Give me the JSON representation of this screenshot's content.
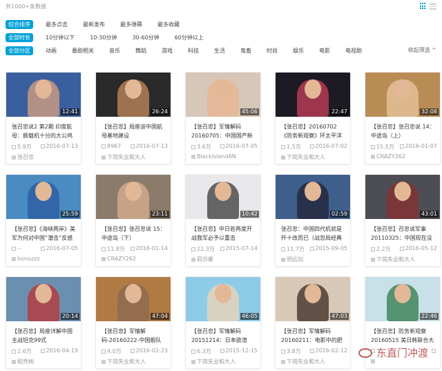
{
  "header": {
    "total": "共1000+条数据"
  },
  "sort_row": [
    "综合排序",
    "最多点击",
    "最新发布",
    "最多弹幕",
    "最多收藏"
  ],
  "duration_row": [
    "全部时长",
    "10分钟以下",
    "10-30分钟",
    "30-60分钟",
    "60分钟以上"
  ],
  "category_row": [
    "全部分区",
    "动画",
    "番剧相关",
    "音乐",
    "舞蹈",
    "游戏",
    "科技",
    "生活",
    "鬼畜",
    "时尚",
    "娱乐",
    "电影",
    "电视剧"
  ],
  "fold_label": "收起筛选 ^",
  "watermark": "东直门冲渡",
  "cards": [
    {
      "title": "张召忠说2 第2期 印度航母：舰载机十分的大公鸡",
      "duration": "12:41",
      "plays": "5.9万",
      "date": "2016-07-13",
      "uploader": "张召忠",
      "bg": "#3a5f9e",
      "fg": "#d9a07e"
    },
    {
      "title": "【张召忠】局座谈中国航母基地建设",
      "duration": "26:24",
      "plays": "8967",
      "date": "2016-07-13",
      "uploader": "下岗失业和大人",
      "bg": "#2a2a2a",
      "fg": "#c58a5c"
    },
    {
      "title": "【张召忠】军情解码20160705：中国国产新航",
      "duration": "45:06",
      "plays": "3.6万",
      "date": "2016-07-05",
      "uploader": "BlackIslandAN",
      "bg": "#d7c7b8",
      "fg": "#e9b48f"
    },
    {
      "title": "【张召忠】20160702《防务新观察》环太平洋中国自",
      "duration": "22:47",
      "plays": "1.5万",
      "date": "2016-07-02",
      "uploader": "下岗失业和大人",
      "bg": "#1d1a24",
      "fg": "#c8405a"
    },
    {
      "title": "【张召忠】张召忠说 14：中途岛（上）",
      "duration": "32:08",
      "plays": "15.5万",
      "date": "2016-01-07",
      "uploader": "CRAZY262",
      "bg": "#b98b55",
      "fg": "#e8c79f"
    },
    {
      "title": "【张召忠】《海峡两岸》美军为何对中国“潜击”反感",
      "duration": "25:59",
      "plays": "--",
      "date": "2016-07-05",
      "uploader": "bonozzz",
      "bg": "#4a8bc2",
      "fg": "#2c5aa0"
    },
    {
      "title": "【张召忠】张召忠说 15：中途岛（下）",
      "duration": "23:11",
      "plays": "11.8万",
      "date": "2016-01-14",
      "uploader": "CRAZY262",
      "bg": "#8b7b6a",
      "fg": "#d9b090"
    },
    {
      "title": "【张召忠】中日若再度开战我军必予以重击",
      "duration": "10:42",
      "plays": "22.3万",
      "date": "2015-07-14",
      "uploader": "莉莎娜",
      "bg": "#e8e8ea",
      "fg": "#3a3a3a"
    },
    {
      "title": "张召忠：中国四代机就是歼十改而已（战忽局经典之",
      "duration": "02:59",
      "plays": "11.7万",
      "date": "2015-09-05",
      "uploader": "明远剑",
      "bg": "#3e5f8c",
      "fg": "#223"
    },
    {
      "title": "【张召忠】召忠说军事 20110325：中国现在没有",
      "duration": "43:01",
      "plays": "2.2万",
      "date": "2016-05-12",
      "uploader": "下岗失业和大人",
      "bg": "#4d4d55",
      "fg": "#8a3030"
    },
    {
      "title": "【张召忠】局座详解中国主战坦克99式",
      "duration": "20:14",
      "plays": "2.6万",
      "date": "2016-04-19",
      "uploader": "稻壳桃",
      "bg": "#6c8fb0",
      "fg": "#b33"
    },
    {
      "title": "【张召忠】军情解码-20160222-中国舰队再",
      "duration": "47:04",
      "plays": "4.0万",
      "date": "2016-02-23",
      "uploader": "下岗失业和大人",
      "bg": "#b07a45",
      "fg": "#8a6a50"
    },
    {
      "title": "【张召忠】军情解码20151214：日本欲渲",
      "duration": "46:05",
      "plays": "6.3万",
      "date": "2015-12-15",
      "uploader": "下岗失业和大人",
      "bg": "#8ecbe8",
      "fg": "#f0d6b4"
    },
    {
      "title": "【张召忠】军情解码20160211：电影中的肥马",
      "duration": "47:03",
      "plays": "3.8万",
      "date": "2016-02-12",
      "uploader": "下岗失业和大人",
      "bg": "#d8c8b8",
      "fg": "#3a2a20"
    },
    {
      "title": "【张召忠】防务新观察20160515 美日韩联合大打",
      "duration": "22:46",
      "plays": "",
      "date": "",
      "uploader": "",
      "bg": "#c8e0e8",
      "fg": "#2f7a4a"
    }
  ]
}
